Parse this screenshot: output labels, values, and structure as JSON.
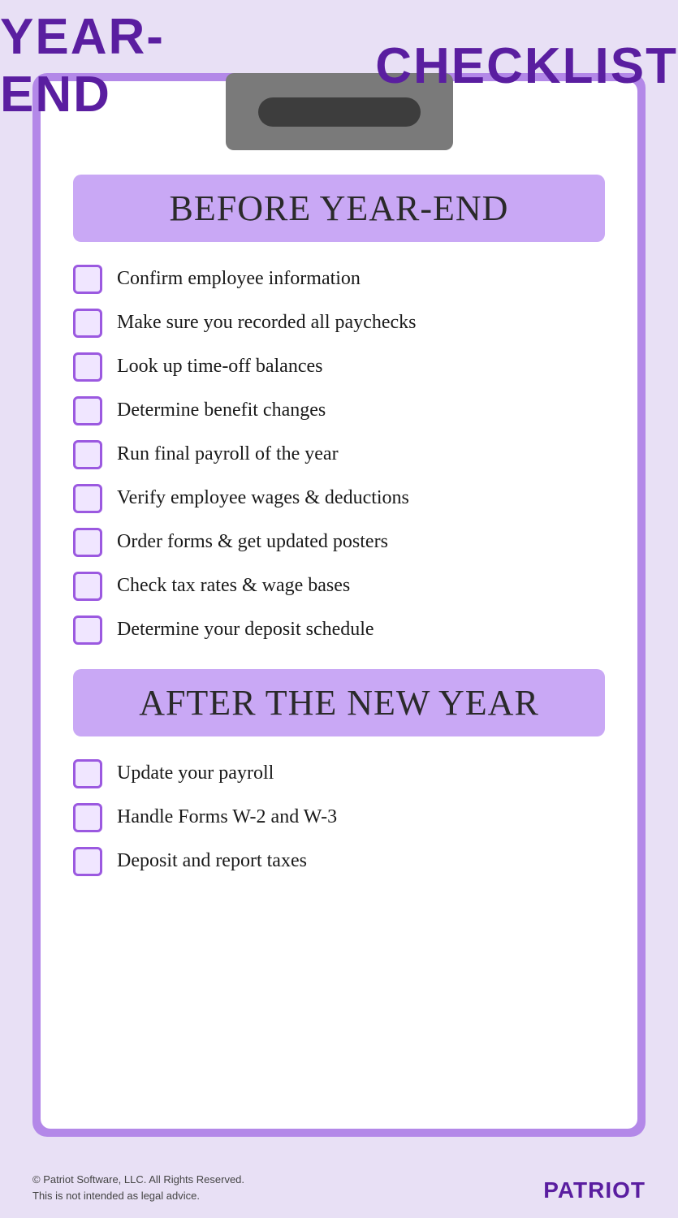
{
  "title": {
    "part1": "YEAR-END",
    "part2": "CHECKLIST"
  },
  "sections": [
    {
      "id": "before-year-end",
      "header": "BEFORE YEAR-END",
      "items": [
        "Confirm employee information",
        "Make sure you recorded all paychecks",
        "Look up time-off balances",
        "Determine benefit changes",
        "Run final payroll of the year",
        "Verify employee wages & deductions",
        "Order forms & get updated posters",
        "Check tax rates & wage bases",
        "Determine your deposit schedule"
      ]
    },
    {
      "id": "after-new-year",
      "header": "AFTER THE NEW YEAR",
      "items": [
        "Update your payroll",
        "Handle Forms W-2 and W-3",
        "Deposit and report taxes"
      ]
    }
  ],
  "footer": {
    "copyright": "© Patriot Software, LLC. All Rights Reserved.",
    "disclaimer": "This is not intended as legal advice.",
    "brand": "PATRIOT"
  },
  "colors": {
    "background": "#e8e0f5",
    "purple_dark": "#5a1ea0",
    "purple_medium": "#b388e8",
    "purple_light": "#c9a8f5",
    "checkbox_border": "#9b59e0",
    "checkbox_bg": "#f0e6ff",
    "clipboard_gray": "#7a7a7a",
    "clip_dark": "#3d3d3d"
  }
}
